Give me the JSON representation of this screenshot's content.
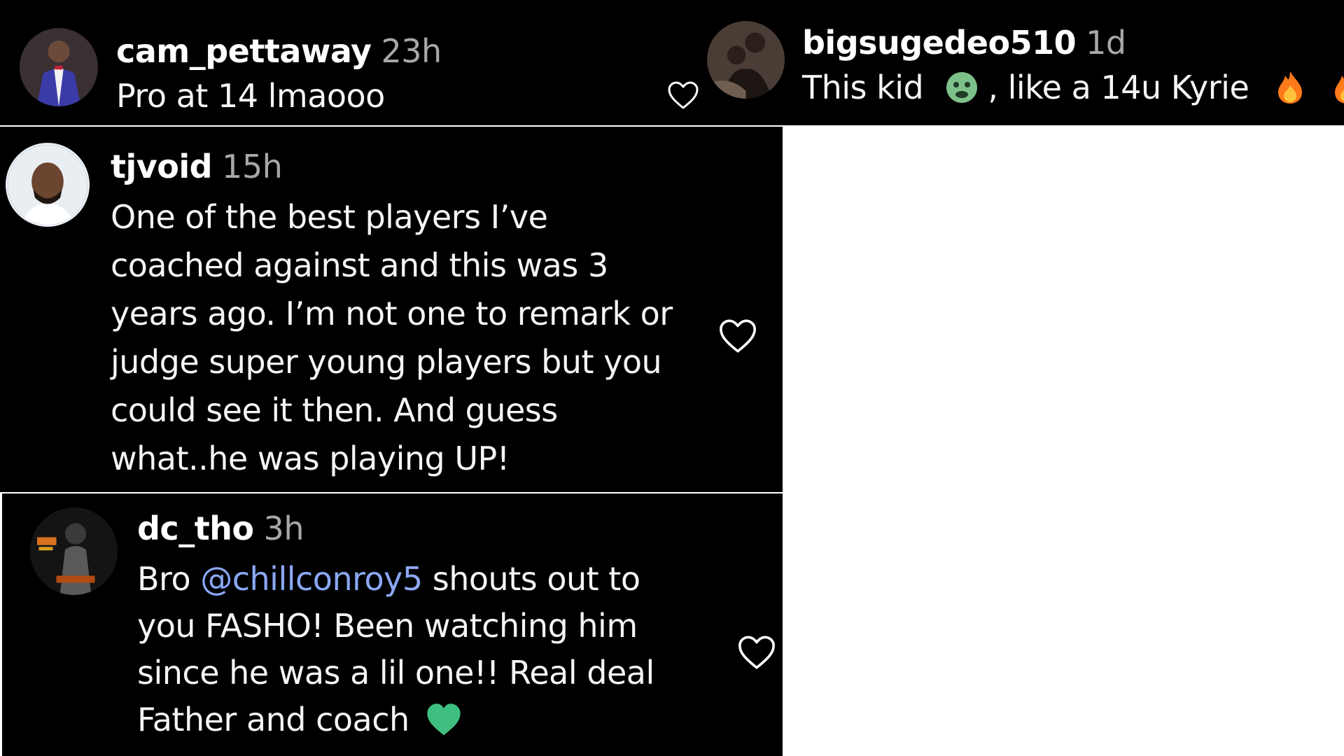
{
  "comments": [
    {
      "username": "cam_pettaway",
      "time": "23h",
      "text": "Pro at 14 lmaooo"
    },
    {
      "username": "bigsugedeo510",
      "time": "1d",
      "text_part1": "This kid",
      "text_part2": ", like a 14u Kyrie",
      "emojis": [
        "nauseated-face-emoji",
        "fire-emoji",
        "fire-emoji"
      ]
    },
    {
      "username": "tjvoid",
      "time": "15h",
      "lines": [
        "One of the best players I’ve",
        "coached against and this was 3",
        "years ago. I’m not one to remark or",
        "judge super young players but you",
        "could see it then. And guess",
        "what..he was playing UP!"
      ]
    },
    {
      "username": "dc_tho",
      "time": "3h",
      "line1_prefix": "Bro ",
      "mention": "@chillconroy5",
      "line1_suffix": " shouts out to",
      "lines": [
        "you FASHO! Been watching him",
        "since he was a lil one!! Real deal"
      ],
      "last_line": "Father and coach",
      "emojis": [
        "green-heart-emoji"
      ]
    }
  ],
  "colors": {
    "background": "#000000",
    "username": "#ffffff",
    "timestamp": "#a8a8a8",
    "mention": "#8ba8f5",
    "green_heart": "#3fbf7f",
    "fire": "#ff7a1a"
  },
  "icons": [
    "heart-outline-icon"
  ]
}
